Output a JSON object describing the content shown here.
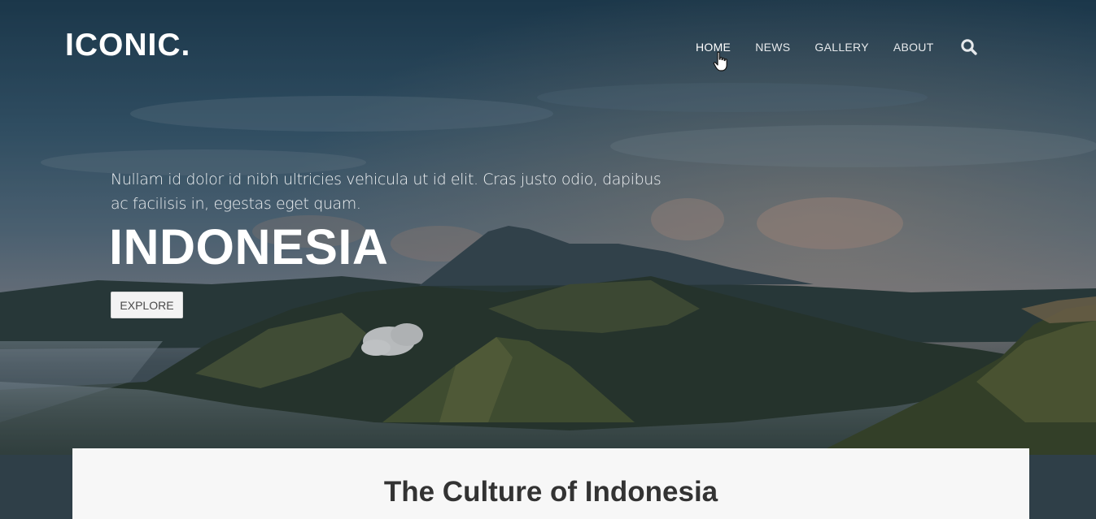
{
  "header": {
    "logo": "ICONIC.",
    "nav": [
      "HOME",
      "NEWS",
      "GALLERY",
      "ABOUT"
    ],
    "active_nav": "HOME",
    "search_icon": "search-icon"
  },
  "hero": {
    "subtitle": "Nullam id dolor id nibh ultricies vehicula ut id elit. Cras justo odio, dapibus ac facilisis in, egestas eget quam.",
    "title": "INDONESIA",
    "button_label": "EXPLORE",
    "background": "volcanic mountain landscape at dusk"
  },
  "section": {
    "heading": "The Culture of Indonesia"
  },
  "colors": {
    "nav_text": "#e6e9ec",
    "button_bg": "#f3f3f3",
    "heading_text": "#333333",
    "card_bg": "#f7f7f7"
  }
}
